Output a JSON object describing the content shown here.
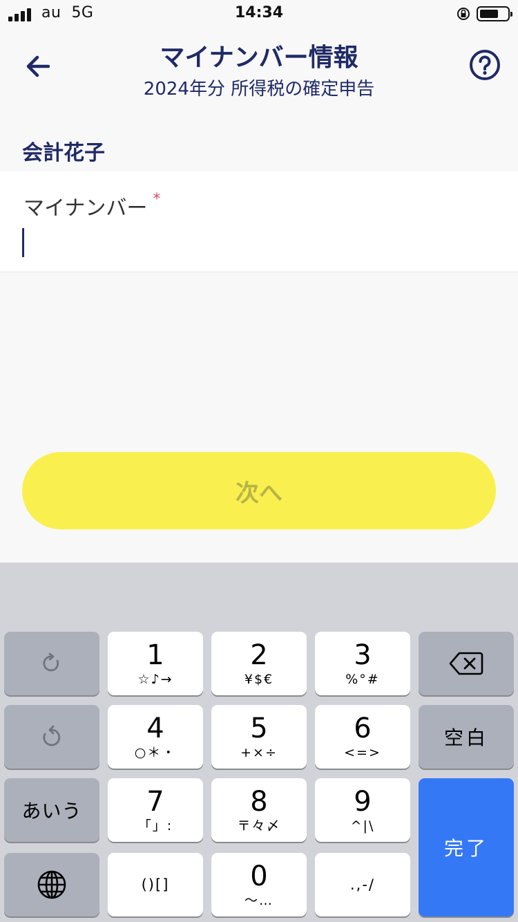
{
  "status_bar": {
    "carrier": "au",
    "network": "5G",
    "time": "14:34"
  },
  "header": {
    "title": "マイナンバー情報",
    "subtitle": "2024年分 所得税の確定申告"
  },
  "person_name": "会計花子",
  "form": {
    "mynumber_label": "マイナンバー",
    "required_mark": "*",
    "mynumber_value": ""
  },
  "next_button_label": "次へ",
  "keyboard": {
    "keys": [
      {
        "num": "1",
        "sub": "☆♪→"
      },
      {
        "num": "2",
        "sub": "¥$€"
      },
      {
        "num": "3",
        "sub": "%°#"
      },
      {
        "num": "4",
        "sub": "○＊・"
      },
      {
        "num": "5",
        "sub": "+×÷"
      },
      {
        "num": "6",
        "sub": "<=>"
      },
      {
        "num": "7",
        "sub": "「」:"
      },
      {
        "num": "8",
        "sub": "〒々〆"
      },
      {
        "num": "9",
        "sub": "^|\\"
      },
      {
        "num": "",
        "sub": "()[]"
      },
      {
        "num": "0",
        "sub": "〜…"
      },
      {
        "num": "",
        "sub": ".,-/"
      }
    ],
    "space_label": "空白",
    "kana_label": "あいう",
    "done_label": "完了"
  },
  "icons": {
    "back": "arrow-left-icon",
    "help": "question-circle-icon",
    "undo": "undo-icon",
    "redo": "redo-icon",
    "delete": "backspace-icon",
    "globe": "globe-icon"
  },
  "colors": {
    "primary_navy": "#1f2a66",
    "button_yellow": "#f9f04f",
    "required_red": "#d84a6a",
    "keyboard_blue": "#3478f6"
  }
}
